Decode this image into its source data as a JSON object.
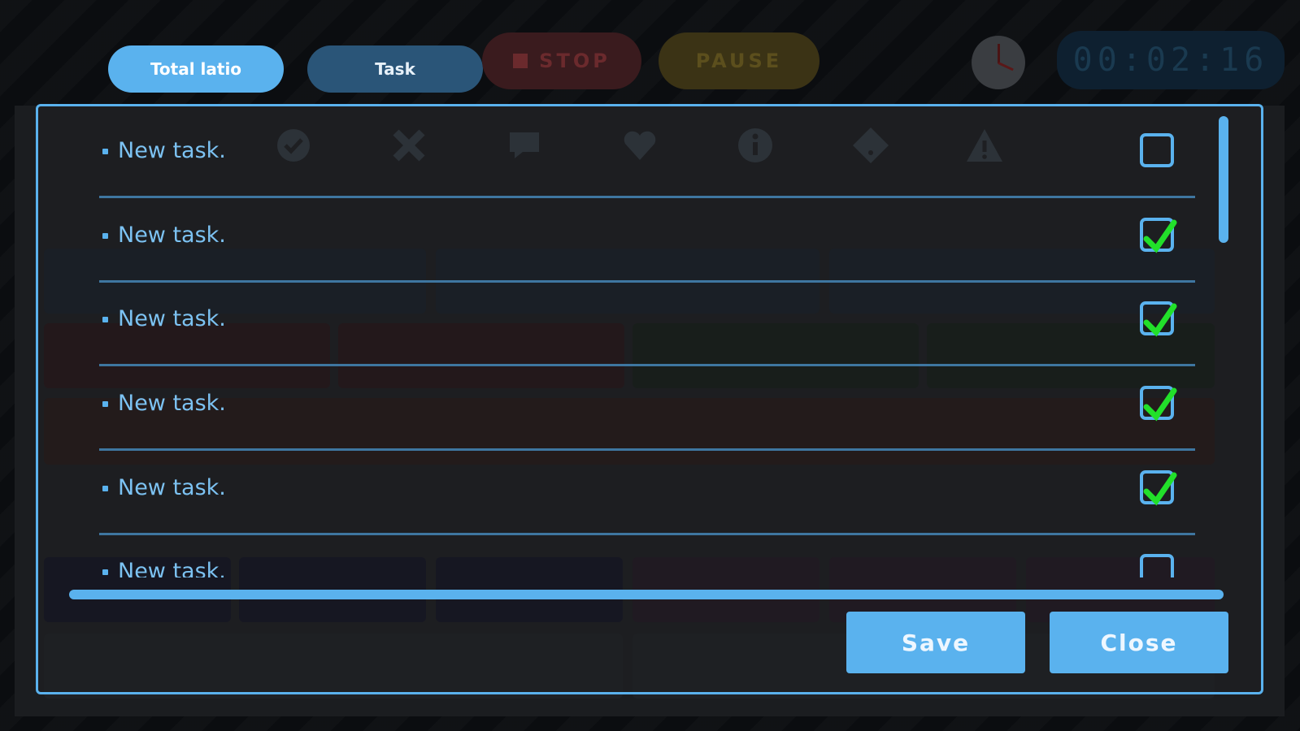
{
  "top_bar": {
    "tabs": [
      {
        "label": "Total latio",
        "active": true
      },
      {
        "label": "Task",
        "active": false
      }
    ],
    "stop_label": "STOP",
    "pause_label": "PAUSE",
    "timer": "00:02:16"
  },
  "task_list": {
    "items": [
      {
        "label": "New task.",
        "checked": false
      },
      {
        "label": "New task.",
        "checked": true
      },
      {
        "label": "New task.",
        "checked": true
      },
      {
        "label": "New task.",
        "checked": true
      },
      {
        "label": "New task.",
        "checked": true
      },
      {
        "label": "New task.",
        "checked": false
      }
    ],
    "row_icons": [
      "check-circle-icon",
      "cross-icon",
      "comment-icon",
      "heart-icon",
      "info-icon",
      "question-diamond-icon",
      "warning-icon"
    ]
  },
  "buttons": {
    "save_label": "Save",
    "close_label": "Close"
  },
  "colors": {
    "accent": "#5ab2ee",
    "tab_inactive": "#2a5578",
    "checkmark": "#22e02a",
    "background": "#0b0d10"
  }
}
